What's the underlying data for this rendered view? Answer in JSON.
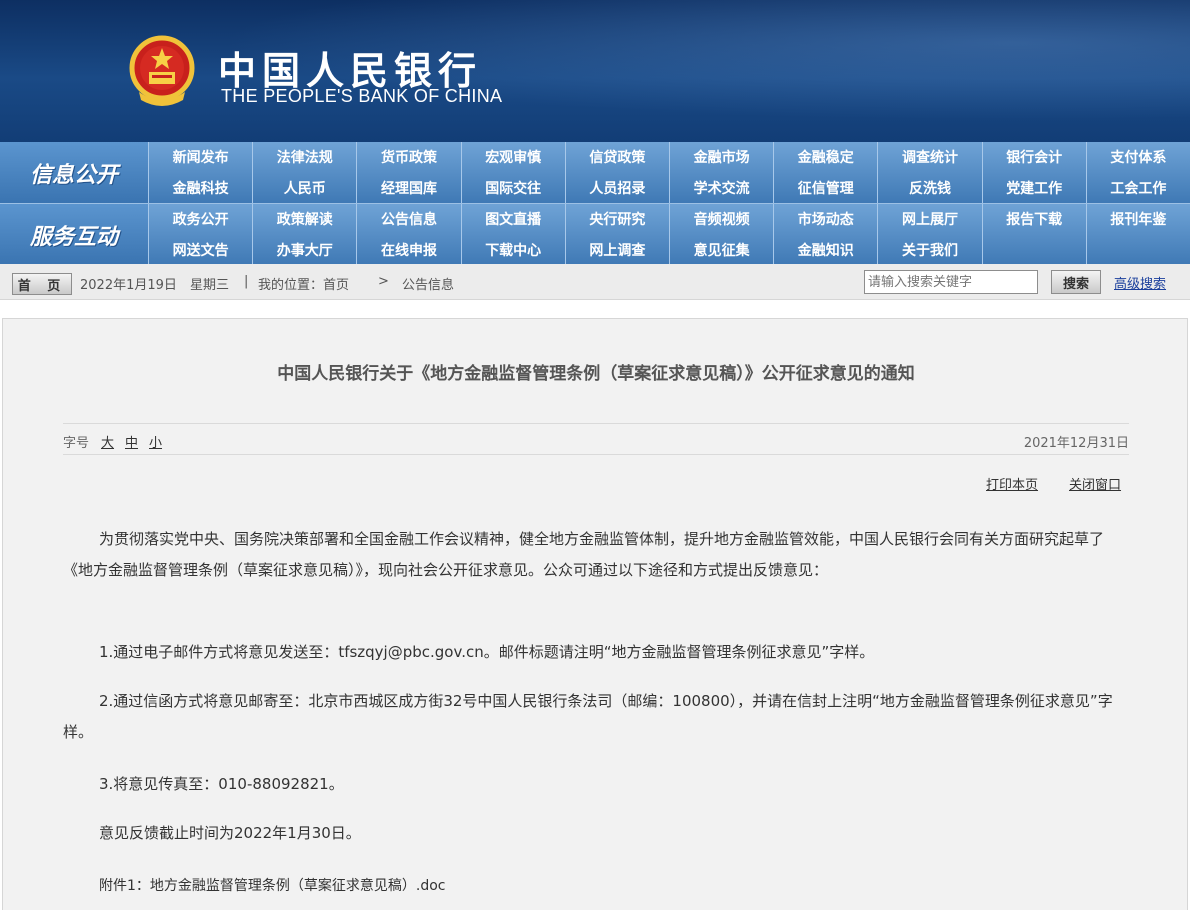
{
  "header": {
    "logo_cn": "中国人民银行",
    "logo_en": "THE PEOPLE'S BANK OF CHINA"
  },
  "nav": {
    "rows": [
      {
        "category": "信息公开",
        "items": [
          "新闻发布",
          "法律法规",
          "货币政策",
          "宏观审慎",
          "信贷政策",
          "金融市场",
          "金融稳定",
          "调查统计",
          "银行会计",
          "支付体系",
          "金融科技",
          "人民币",
          "经理国库",
          "国际交往",
          "人员招录",
          "学术交流",
          "征信管理",
          "反洗钱",
          "党建工作",
          "工会工作"
        ]
      },
      {
        "category": "服务互动",
        "items": [
          "政务公开",
          "政策解读",
          "公告信息",
          "图文直播",
          "央行研究",
          "音频视频",
          "市场动态",
          "网上展厅",
          "报告下载",
          "报刊年鉴",
          "网送文告",
          "办事大厅",
          "在线申报",
          "下载中心",
          "网上调查",
          "意见征集",
          "金融知识",
          "关于我们",
          "",
          ""
        ]
      }
    ]
  },
  "crumb": {
    "home": "首 页",
    "date": "2022年1月19日",
    "weekday": "星期三",
    "sep": "|",
    "location_label": "我的位置：首页",
    "arrow": ">",
    "current": "公告信息",
    "search_placeholder": "请输入搜索关键字",
    "search_button": "搜索",
    "advanced_search": "高级搜索"
  },
  "article": {
    "title": "中国人民银行关于《地方金融监督管理条例（草案征求意见稿）》公开征求意见的通知",
    "font_label": "字号",
    "font_large": "大",
    "font_medium": "中",
    "font_small": "小",
    "date": "2021年12月31日",
    "print": "打印本页",
    "close": "关闭窗口",
    "paragraphs": [
      "为贯彻落实党中央、国务院决策部署和全国金融工作会议精神，健全地方金融监管体制，提升地方金融监管效能，中国人民银行会同有关方面研究起草了《地方金融监督管理条例（草案征求意见稿）》，现向社会公开征求意见。公众可通过以下途径和方式提出反馈意见：",
      "1.通过电子邮件方式将意见发送至：tfszqyj@pbc.gov.cn。邮件标题请注明“地方金融监督管理条例征求意见”字样。",
      "2.通过信函方式将意见邮寄至：北京市西城区成方街32号中国人民银行条法司（邮编：100800），并请在信封上注明“地方金融监督管理条例征求意见”字样。",
      "3.将意见传真至：010-88092821。",
      "意见反馈截止时间为2022年1月30日。",
      "附件1：地方金融监督管理条例（草案征求意见稿）.doc"
    ]
  }
}
